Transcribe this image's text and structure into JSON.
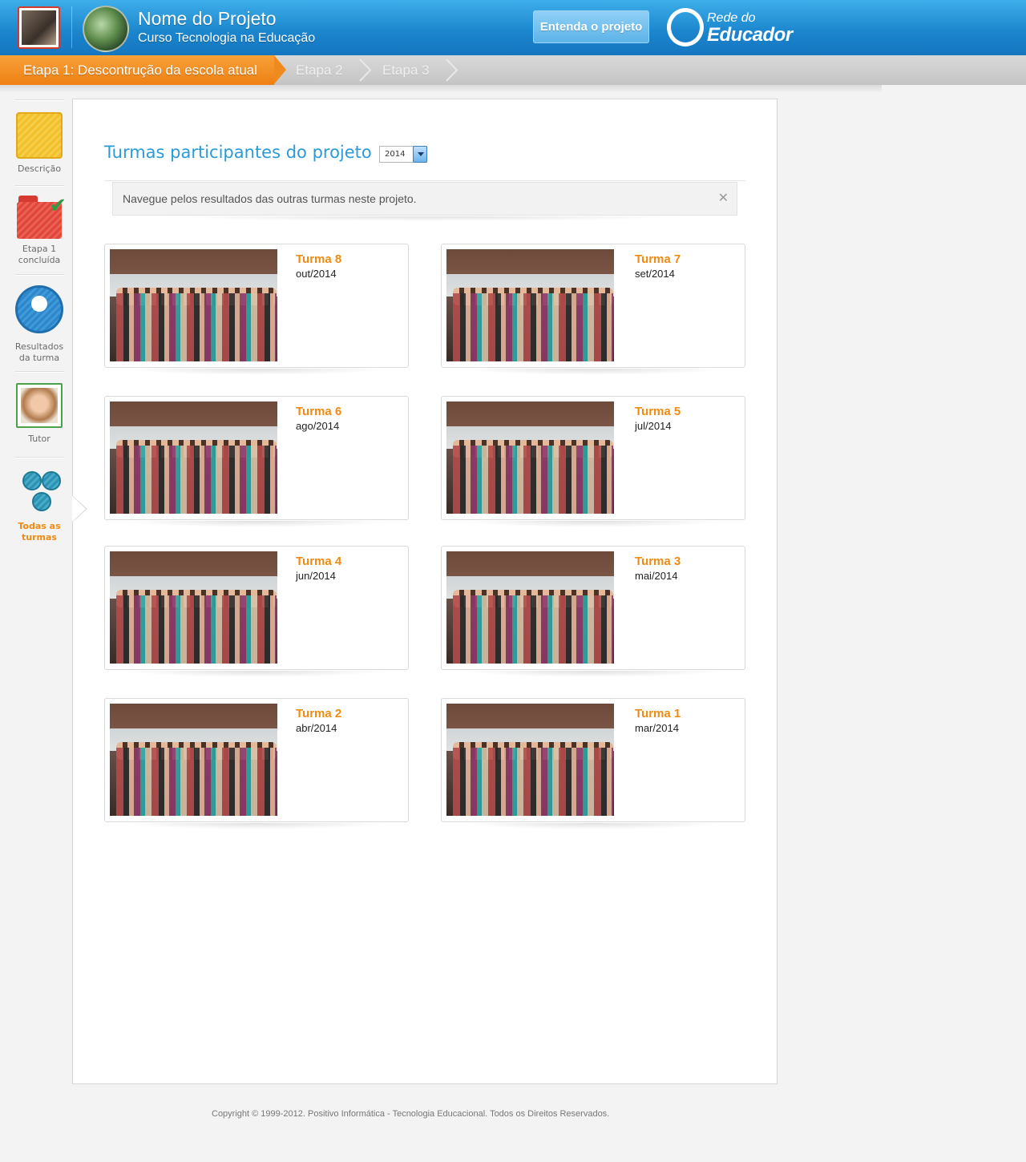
{
  "header": {
    "project_title": "Nome do Projeto",
    "project_subtitle": "Curso Tecnologia na Educação",
    "cta_label": "Entenda o projeto",
    "logo_line1": "Rede do",
    "logo_line2": "Educador"
  },
  "steps": {
    "active": "Etapa 1: Descontrução da escola atual",
    "step2": "Etapa 2",
    "step3": "Etapa 3"
  },
  "sidebar": {
    "items": [
      {
        "label": "Descrição",
        "icon": "notepad-icon"
      },
      {
        "label_line1": "Etapa 1",
        "label_line2": "concluída",
        "icon": "folder-check-icon"
      },
      {
        "label_line1": "Resultados",
        "label_line2": "da turma",
        "icon": "user-group-icon"
      },
      {
        "label": "Tutor",
        "icon": "tutor-photo-icon"
      },
      {
        "label_line1": "Todas as",
        "label_line2": "turmas",
        "icon": "all-groups-icon",
        "active": true
      }
    ]
  },
  "main": {
    "title": "Turmas participantes do projeto",
    "year_selected": "2014",
    "notice": "Navegue pelos resultados das outras turmas neste projeto.",
    "notice_close": "✕",
    "turmas": [
      {
        "name": "Turma 8",
        "date": "out/2014"
      },
      {
        "name": "Turma 7",
        "date": "set/2014"
      },
      {
        "name": "Turma 6",
        "date": "ago/2014"
      },
      {
        "name": "Turma 5",
        "date": "jul/2014"
      },
      {
        "name": "Turma 4",
        "date": "jun/2014"
      },
      {
        "name": "Turma 3",
        "date": "mai/2014"
      },
      {
        "name": "Turma 2",
        "date": "abr/2014"
      },
      {
        "name": "Turma 1",
        "date": "mar/2014"
      }
    ]
  },
  "footer": {
    "copyright": "Copyright © 1999-2012.  Positivo Informática - Tecnologia Educacional. Todos os Direitos Reservados."
  },
  "colors": {
    "header_blue": "#1a84cc",
    "accent_orange": "#f08a12",
    "title_blue": "#2b9bd8"
  }
}
